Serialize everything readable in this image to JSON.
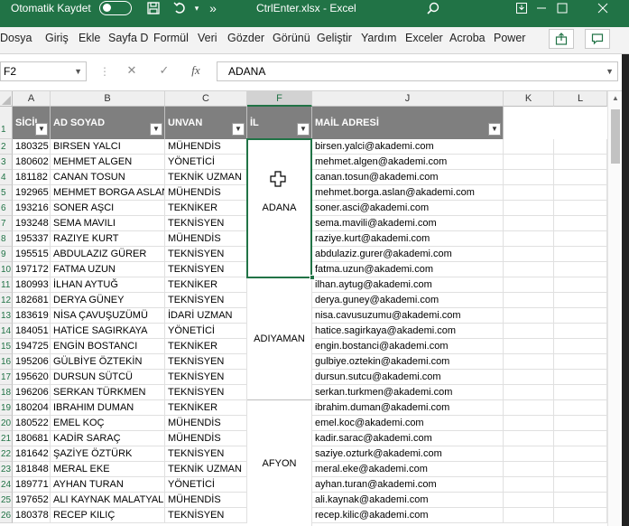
{
  "titlebar": {
    "autosave_label": "Otomatik Kaydet",
    "autosave_state": "off",
    "title": "CtrlEnter.xlsx  -  Excel",
    "more_label": "»",
    "accent": "#217346"
  },
  "ribbon": {
    "tabs": [
      "Dosya",
      "Giriş",
      "Ekle",
      "Sayfa D",
      "Formül",
      "Veri",
      "Gözder",
      "Görünü",
      "Geliştir",
      "Yardım",
      "Exceler",
      "Acroba",
      "Power"
    ]
  },
  "formula_bar": {
    "name_box": "F2",
    "cancel_icon": "✕",
    "enter_icon": "✓",
    "fx_label": "fx",
    "value": "ADANA"
  },
  "columns": [
    {
      "label": "A",
      "selected": false
    },
    {
      "label": "B",
      "selected": false
    },
    {
      "label": "C",
      "selected": false
    },
    {
      "label": "F",
      "selected": true
    },
    {
      "label": "J",
      "selected": false
    },
    {
      "label": "K",
      "selected": false
    },
    {
      "label": "L",
      "selected": false
    }
  ],
  "row_numbers": [
    "1",
    "2",
    "3",
    "4",
    "5",
    "6",
    "7",
    "8",
    "9",
    "10",
    "11",
    "12",
    "13",
    "14",
    "15",
    "16",
    "17",
    "18",
    "19",
    "20",
    "21",
    "22",
    "23",
    "24",
    "25",
    "26"
  ],
  "headers": [
    "SİCİL",
    "AD SOYAD",
    "UNVAN",
    "İL",
    "MAİL ADRESİ"
  ],
  "merged_cities": [
    "ADANA",
    "ADIYAMAN",
    "AFYON"
  ],
  "rows": [
    {
      "sicil": "180325",
      "name": "BIRSEN YALCI",
      "title": "MÜHENDİS",
      "mail": "birsen.yalci@akademi.com"
    },
    {
      "sicil": "180602",
      "name": "MEHMET ALGEN",
      "title": "YÖNETİCİ",
      "mail": "mehmet.algen@akademi.com"
    },
    {
      "sicil": "181182",
      "name": "CANAN TOSUN",
      "title": "TEKNİK UZMAN",
      "mail": "canan.tosun@akademi.com"
    },
    {
      "sicil": "192965",
      "name": "MEHMET BORGA ASLAN",
      "title": "MÜHENDİS",
      "mail": "mehmet.borga.aslan@akademi.com"
    },
    {
      "sicil": "193216",
      "name": "SONER AŞCI",
      "title": "TEKNİKER",
      "mail": "soner.asci@akademi.com"
    },
    {
      "sicil": "193248",
      "name": "SEMA MAVILI",
      "title": "TEKNİSYEN",
      "mail": "sema.mavili@akademi.com"
    },
    {
      "sicil": "195337",
      "name": "RAZIYE KURT",
      "title": "MÜHENDİS",
      "mail": "raziye.kurt@akademi.com"
    },
    {
      "sicil": "195515",
      "name": "ABDULAZIZ GÜRER",
      "title": "TEKNİSYEN",
      "mail": "abdulaziz.gurer@akademi.com"
    },
    {
      "sicil": "197172",
      "name": "FATMA UZUN",
      "title": "TEKNİSYEN",
      "mail": "fatma.uzun@akademi.com"
    },
    {
      "sicil": "180993",
      "name": "İLHAN AYTUĞ",
      "title": "TEKNİKER",
      "mail": "ilhan.aytug@akademi.com"
    },
    {
      "sicil": "182681",
      "name": "DERYA GÜNEY",
      "title": "TEKNİSYEN",
      "mail": "derya.guney@akademi.com"
    },
    {
      "sicil": "183619",
      "name": "NİSA ÇAVUŞUZÜMÜ",
      "title": "İDARİ UZMAN",
      "mail": "nisa.cavusuzumu@akademi.com"
    },
    {
      "sicil": "184051",
      "name": "HATİCE SAGIRKAYA",
      "title": "YÖNETİCİ",
      "mail": "hatice.sagirkaya@akademi.com"
    },
    {
      "sicil": "194725",
      "name": "ENGİN BOSTANCI",
      "title": "TEKNİKER",
      "mail": "engin.bostanci@akademi.com"
    },
    {
      "sicil": "195206",
      "name": "GÜLBİYE ÖZTEKİN",
      "title": "TEKNİSYEN",
      "mail": "gulbiye.oztekin@akademi.com"
    },
    {
      "sicil": "195620",
      "name": "DURSUN SÜTCÜ",
      "title": "TEKNİSYEN",
      "mail": "dursun.sutcu@akademi.com"
    },
    {
      "sicil": "196206",
      "name": "SERKAN TÜRKMEN",
      "title": "TEKNİSYEN",
      "mail": "serkan.turkmen@akademi.com"
    },
    {
      "sicil": "180204",
      "name": "IBRAHIM DUMAN",
      "title": "TEKNİKER",
      "mail": "ibrahim.duman@akademi.com"
    },
    {
      "sicil": "180522",
      "name": "EMEL KOÇ",
      "title": "MÜHENDİS",
      "mail": "emel.koc@akademi.com"
    },
    {
      "sicil": "180681",
      "name": "KADİR SARAÇ",
      "title": "MÜHENDİS",
      "mail": "kadir.sarac@akademi.com"
    },
    {
      "sicil": "181642",
      "name": "ŞAZİYE ÖZTÜRK",
      "title": "TEKNİSYEN",
      "mail": "saziye.ozturk@akademi.com"
    },
    {
      "sicil": "181848",
      "name": "MERAL EKE",
      "title": "TEKNİK UZMAN",
      "mail": "meral.eke@akademi.com"
    },
    {
      "sicil": "189771",
      "name": "AYHAN TURAN",
      "title": "YÖNETİCİ",
      "mail": "ayhan.turan@akademi.com"
    },
    {
      "sicil": "197652",
      "name": "ALI KAYNAK MALATYALI",
      "title": "MÜHENDİS",
      "mail": "ali.kaynak@akademi.com"
    },
    {
      "sicil": "180378",
      "name": "RECEP KILIÇ",
      "title": "TEKNİSYEN",
      "mail": "recep.kilic@akademi.com"
    }
  ]
}
